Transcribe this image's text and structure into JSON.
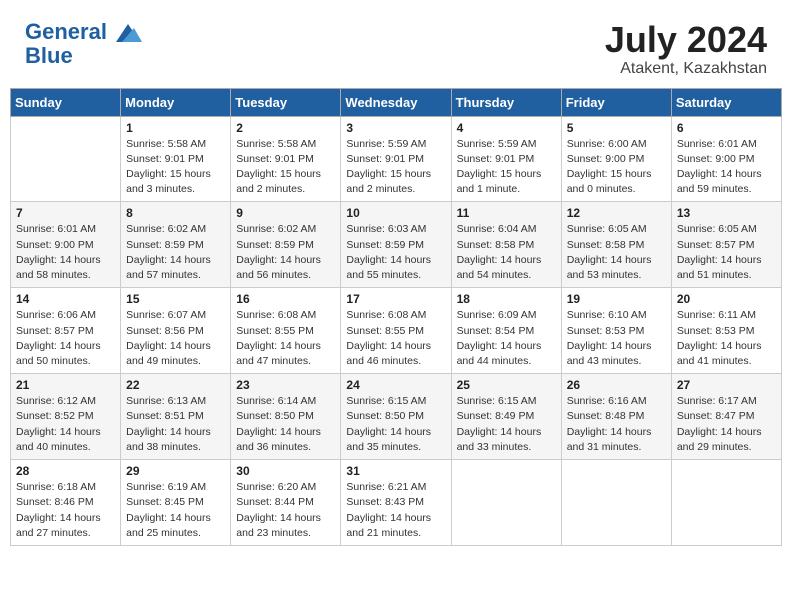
{
  "header": {
    "logo_line1": "General",
    "logo_line2": "Blue",
    "month_title": "July 2024",
    "location": "Atakent, Kazakhstan"
  },
  "weekdays": [
    "Sunday",
    "Monday",
    "Tuesday",
    "Wednesday",
    "Thursday",
    "Friday",
    "Saturday"
  ],
  "weeks": [
    [
      {
        "day": "",
        "info": ""
      },
      {
        "day": "1",
        "info": "Sunrise: 5:58 AM\nSunset: 9:01 PM\nDaylight: 15 hours\nand 3 minutes."
      },
      {
        "day": "2",
        "info": "Sunrise: 5:58 AM\nSunset: 9:01 PM\nDaylight: 15 hours\nand 2 minutes."
      },
      {
        "day": "3",
        "info": "Sunrise: 5:59 AM\nSunset: 9:01 PM\nDaylight: 15 hours\nand 2 minutes."
      },
      {
        "day": "4",
        "info": "Sunrise: 5:59 AM\nSunset: 9:01 PM\nDaylight: 15 hours\nand 1 minute."
      },
      {
        "day": "5",
        "info": "Sunrise: 6:00 AM\nSunset: 9:00 PM\nDaylight: 15 hours\nand 0 minutes."
      },
      {
        "day": "6",
        "info": "Sunrise: 6:01 AM\nSunset: 9:00 PM\nDaylight: 14 hours\nand 59 minutes."
      }
    ],
    [
      {
        "day": "7",
        "info": "Sunrise: 6:01 AM\nSunset: 9:00 PM\nDaylight: 14 hours\nand 58 minutes."
      },
      {
        "day": "8",
        "info": "Sunrise: 6:02 AM\nSunset: 8:59 PM\nDaylight: 14 hours\nand 57 minutes."
      },
      {
        "day": "9",
        "info": "Sunrise: 6:02 AM\nSunset: 8:59 PM\nDaylight: 14 hours\nand 56 minutes."
      },
      {
        "day": "10",
        "info": "Sunrise: 6:03 AM\nSunset: 8:59 PM\nDaylight: 14 hours\nand 55 minutes."
      },
      {
        "day": "11",
        "info": "Sunrise: 6:04 AM\nSunset: 8:58 PM\nDaylight: 14 hours\nand 54 minutes."
      },
      {
        "day": "12",
        "info": "Sunrise: 6:05 AM\nSunset: 8:58 PM\nDaylight: 14 hours\nand 53 minutes."
      },
      {
        "day": "13",
        "info": "Sunrise: 6:05 AM\nSunset: 8:57 PM\nDaylight: 14 hours\nand 51 minutes."
      }
    ],
    [
      {
        "day": "14",
        "info": "Sunrise: 6:06 AM\nSunset: 8:57 PM\nDaylight: 14 hours\nand 50 minutes."
      },
      {
        "day": "15",
        "info": "Sunrise: 6:07 AM\nSunset: 8:56 PM\nDaylight: 14 hours\nand 49 minutes."
      },
      {
        "day": "16",
        "info": "Sunrise: 6:08 AM\nSunset: 8:55 PM\nDaylight: 14 hours\nand 47 minutes."
      },
      {
        "day": "17",
        "info": "Sunrise: 6:08 AM\nSunset: 8:55 PM\nDaylight: 14 hours\nand 46 minutes."
      },
      {
        "day": "18",
        "info": "Sunrise: 6:09 AM\nSunset: 8:54 PM\nDaylight: 14 hours\nand 44 minutes."
      },
      {
        "day": "19",
        "info": "Sunrise: 6:10 AM\nSunset: 8:53 PM\nDaylight: 14 hours\nand 43 minutes."
      },
      {
        "day": "20",
        "info": "Sunrise: 6:11 AM\nSunset: 8:53 PM\nDaylight: 14 hours\nand 41 minutes."
      }
    ],
    [
      {
        "day": "21",
        "info": "Sunrise: 6:12 AM\nSunset: 8:52 PM\nDaylight: 14 hours\nand 40 minutes."
      },
      {
        "day": "22",
        "info": "Sunrise: 6:13 AM\nSunset: 8:51 PM\nDaylight: 14 hours\nand 38 minutes."
      },
      {
        "day": "23",
        "info": "Sunrise: 6:14 AM\nSunset: 8:50 PM\nDaylight: 14 hours\nand 36 minutes."
      },
      {
        "day": "24",
        "info": "Sunrise: 6:15 AM\nSunset: 8:50 PM\nDaylight: 14 hours\nand 35 minutes."
      },
      {
        "day": "25",
        "info": "Sunrise: 6:15 AM\nSunset: 8:49 PM\nDaylight: 14 hours\nand 33 minutes."
      },
      {
        "day": "26",
        "info": "Sunrise: 6:16 AM\nSunset: 8:48 PM\nDaylight: 14 hours\nand 31 minutes."
      },
      {
        "day": "27",
        "info": "Sunrise: 6:17 AM\nSunset: 8:47 PM\nDaylight: 14 hours\nand 29 minutes."
      }
    ],
    [
      {
        "day": "28",
        "info": "Sunrise: 6:18 AM\nSunset: 8:46 PM\nDaylight: 14 hours\nand 27 minutes."
      },
      {
        "day": "29",
        "info": "Sunrise: 6:19 AM\nSunset: 8:45 PM\nDaylight: 14 hours\nand 25 minutes."
      },
      {
        "day": "30",
        "info": "Sunrise: 6:20 AM\nSunset: 8:44 PM\nDaylight: 14 hours\nand 23 minutes."
      },
      {
        "day": "31",
        "info": "Sunrise: 6:21 AM\nSunset: 8:43 PM\nDaylight: 14 hours\nand 21 minutes."
      },
      {
        "day": "",
        "info": ""
      },
      {
        "day": "",
        "info": ""
      },
      {
        "day": "",
        "info": ""
      }
    ]
  ]
}
